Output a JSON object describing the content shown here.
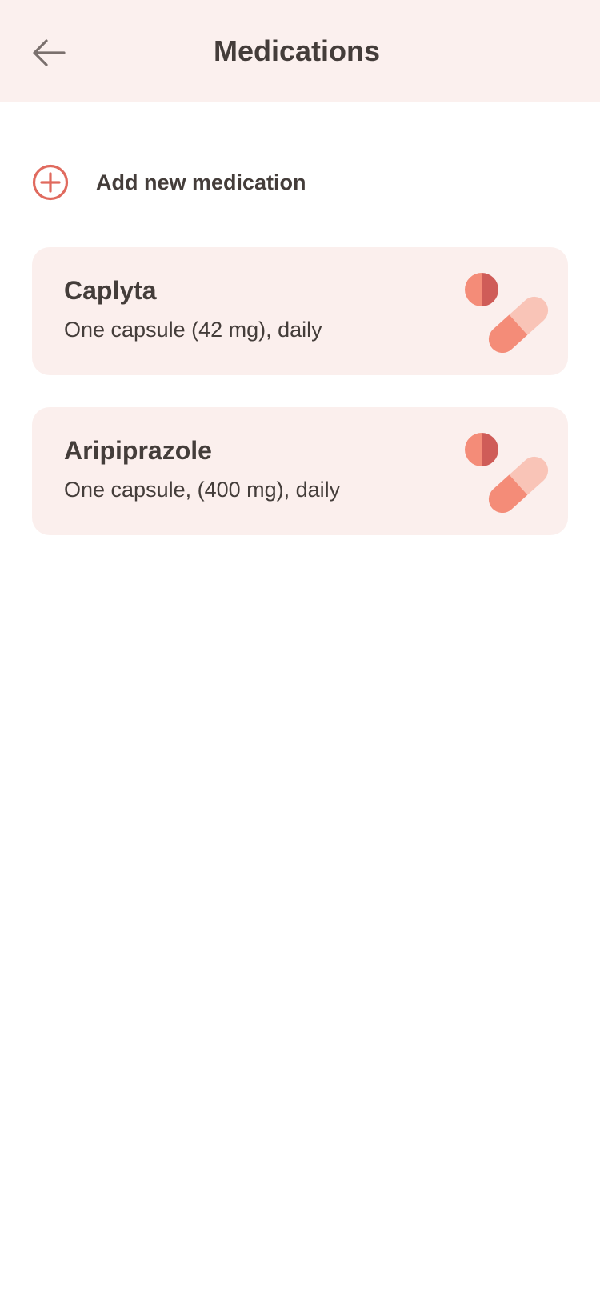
{
  "header": {
    "title": "Medications",
    "back_icon": "arrow-left-icon"
  },
  "add_action": {
    "label": "Add new medication",
    "icon": "plus-circle-icon"
  },
  "medications": [
    {
      "name": "Caplyta",
      "dosage": "One capsule (42 mg), daily",
      "icon": "pills-icon"
    },
    {
      "name": "Aripiprazole",
      "dosage": "One capsule, (400 mg), daily",
      "icon": "pills-icon"
    }
  ],
  "colors": {
    "header_bg": "#fbf0ee",
    "card_bg": "#fbefed",
    "text": "#443d3a",
    "accent": "#e06a5e",
    "pill_light": "#f9c4b7",
    "pill_mid": "#f48c78",
    "pill_dark": "#cf5c58"
  }
}
